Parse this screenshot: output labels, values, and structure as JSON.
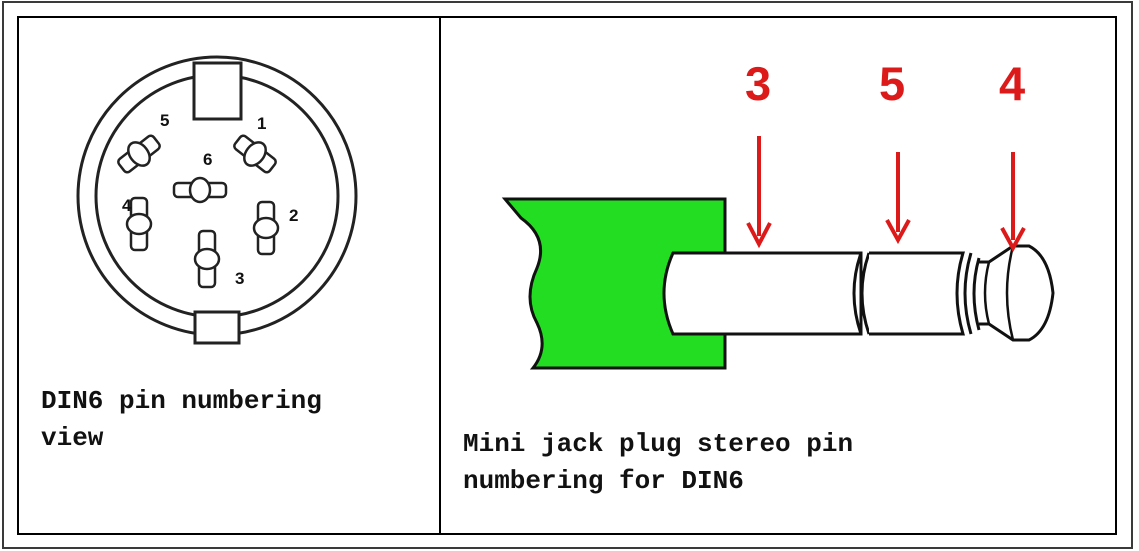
{
  "din6_caption": "DIN6 pin numbering\nview",
  "jack_caption": "Mini jack plug stereo pin\nnumbering for DIN6",
  "din6_pins": [
    "1",
    "2",
    "3",
    "4",
    "5",
    "6"
  ],
  "jack_pins": [
    "3",
    "5",
    "4"
  ],
  "colors": {
    "handle": "#22dd22",
    "arrow": "#dd1a1a",
    "outline": "#111111"
  }
}
